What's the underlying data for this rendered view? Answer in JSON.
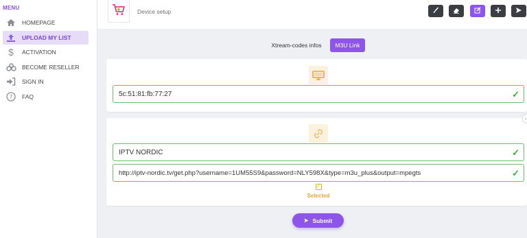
{
  "sidebar": {
    "heading": "MENU",
    "items": [
      {
        "label": "HOMEPAGE",
        "icon": "home-icon"
      },
      {
        "label": "UPLOAD MY LIST",
        "icon": "upload-icon",
        "active": true
      },
      {
        "label": "ACTIVATION",
        "icon": "dollar-icon"
      },
      {
        "label": "BECOME RESELLER",
        "icon": "reseller-icon"
      },
      {
        "label": "SIGN IN",
        "icon": "sign-in-icon"
      },
      {
        "label": "FAQ",
        "icon": "question-icon"
      }
    ]
  },
  "header": {
    "title": "Device setup",
    "logo_icon": "cart-icon",
    "toolbar": [
      {
        "icon": "brush-icon"
      },
      {
        "icon": "eraser-icon"
      },
      {
        "icon": "edit-icon",
        "active": true
      },
      {
        "icon": "plus-icon"
      },
      {
        "icon": "send-icon"
      }
    ]
  },
  "tabs": {
    "xtream_label": "Xtream-codes infos",
    "m3u_label": "M3U Link",
    "active": "M3U Link"
  },
  "device_card": {
    "icon": "monitor-icon",
    "mac_value": "5c:51:81:fb:77:27"
  },
  "playlist_card": {
    "icon": "link-icon",
    "name_value": "IPTV NORDIC",
    "url_value": "http://iptv-nordic.tv/get.php?username=1UM55S9&password=NLY598X&type=m3u_plus&output=mpegts",
    "selected_label": "Selected"
  },
  "submit": {
    "label": "Submit"
  },
  "colors": {
    "accent": "#8d55e8",
    "valid": "#3cae3c",
    "selected": "#e4a83a",
    "toolbar_dark": "#3a3d42"
  }
}
